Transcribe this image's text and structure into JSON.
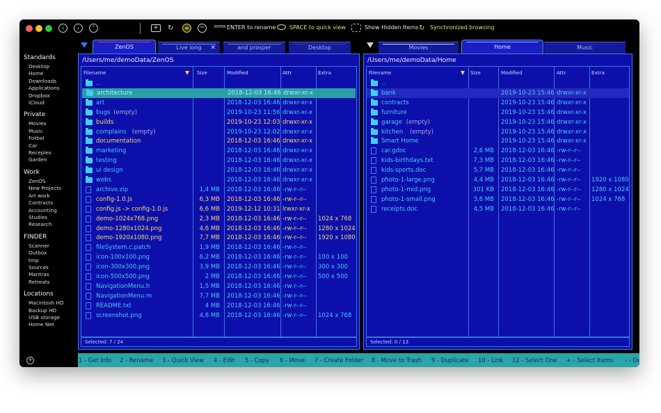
{
  "toolbar": {
    "nav": [
      "back",
      "forward",
      "up"
    ],
    "rename_hint_icon": "ENTER",
    "rename_hint": "ENTER to rename",
    "quickview_hint": "SPACE to quick view",
    "hidden_items": "Show Hidden Items",
    "sync_browsing": "Synchronized browsing"
  },
  "sidebar": {
    "groups": [
      {
        "title": "Standards",
        "items": [
          "Desktop",
          "Home",
          "Downloads",
          "Applications",
          "Dropbox",
          "iCloud"
        ]
      },
      {
        "title": "Private",
        "items": [
          "Movies",
          "Music",
          "Fotbal",
          "Car",
          "Recepies",
          "Garden"
        ]
      },
      {
        "title": "Work",
        "items": [
          "ZenOS",
          "New Projects",
          "Art work",
          "Contracts",
          "Accounting",
          "Studies",
          "Research"
        ]
      },
      {
        "title": "FINDER",
        "items": [
          "Scanner",
          "Outbox",
          "tmp",
          "Sources",
          "Mantras",
          "Retreats"
        ]
      },
      {
        "title": "Locations",
        "items": [
          "Macintosh HD",
          "Backup HD",
          "USB storage",
          "Home Net"
        ]
      }
    ],
    "add_icon": "+"
  },
  "left_tabs": [
    {
      "label": "ZenOS",
      "active": true,
      "accent": "#d83a6a"
    },
    {
      "label": "Live long",
      "active": false,
      "accent": "#6a8cff",
      "closable": true
    },
    {
      "label": "and prosper",
      "active": false,
      "accent": "#7a8aa0"
    },
    {
      "label": "Desktop",
      "active": false,
      "accent": "#5a2aa8"
    }
  ],
  "right_tabs": [
    {
      "label": "Movies",
      "active": false,
      "accent": "#cfd6ff"
    },
    {
      "label": "Home",
      "active": true,
      "accent": "#7fb0ff"
    },
    {
      "label": "Music",
      "active": false,
      "accent": "#1a1fc4"
    }
  ],
  "columns": {
    "filename": "Filename",
    "size": "Size",
    "modified": "Modified",
    "attr": "Attr",
    "extra": "Extra"
  },
  "left_pane": {
    "path": "/Users/me/demoData/ZenOS",
    "status": "Selected: 7 / 24",
    "rows": [
      {
        "type": "folder",
        "name": "..",
        "note": "",
        "size": "",
        "modified": "",
        "attr": "",
        "extra": "",
        "style": "default"
      },
      {
        "type": "folder",
        "name": "architecture",
        "note": "",
        "size": "",
        "modified": "2018-12-03 16:46",
        "attr": "drwxr-xr-x",
        "extra": "",
        "style": "cursor"
      },
      {
        "type": "folder",
        "name": "art",
        "note": "",
        "size": "",
        "modified": "2018-12-03 16:46",
        "attr": "drwxr-xr-x",
        "extra": "",
        "style": "default"
      },
      {
        "type": "folder",
        "name": "bugs",
        "note": "(empty)",
        "size": "",
        "modified": "2019-10-23 11:56",
        "attr": "drwxr-xr-x",
        "extra": "",
        "style": "default"
      },
      {
        "type": "folder",
        "name": "builds",
        "note": "",
        "size": "",
        "modified": "2019-10-23 12:03",
        "attr": "drwxr-xr-x",
        "extra": "",
        "style": "selected"
      },
      {
        "type": "folder",
        "name": "complains",
        "note": "(empty)",
        "size": "",
        "modified": "2019-10-23 12:02",
        "attr": "drwxr-xr-x",
        "extra": "",
        "style": "default"
      },
      {
        "type": "folder",
        "name": "documentation",
        "note": "",
        "size": "",
        "modified": "2018-12-03 16:46",
        "attr": "drwxr-xr-x",
        "extra": "",
        "style": "selected"
      },
      {
        "type": "folder",
        "name": "marketing",
        "note": "",
        "size": "",
        "modified": "2018-12-03 16:46",
        "attr": "drwxr-xr-x",
        "extra": "",
        "style": "default"
      },
      {
        "type": "folder",
        "name": "testing",
        "note": "",
        "size": "",
        "modified": "2018-12-03 16:46",
        "attr": "drwxr-xr-x",
        "extra": "",
        "style": "default"
      },
      {
        "type": "folder",
        "name": "ui design",
        "note": "",
        "size": "",
        "modified": "2018-12-03 16:46",
        "attr": "drwxr-xr-x",
        "extra": "",
        "style": "default"
      },
      {
        "type": "folder",
        "name": "webs",
        "note": "",
        "size": "",
        "modified": "2018-12-03 16:46",
        "attr": "drwxr-xr-x",
        "extra": "",
        "style": "default"
      },
      {
        "type": "file",
        "name": "archive.zip",
        "note": "",
        "size": "1,4 MB",
        "modified": "2018-12-03 16:46",
        "attr": "-rw-r--r--",
        "extra": "",
        "style": "default"
      },
      {
        "type": "file",
        "name": "config-1.0.js",
        "note": "",
        "size": "6,3 MB",
        "modified": "2018-12-03 16:46",
        "attr": "-rw-r--r--",
        "extra": "",
        "style": "selected"
      },
      {
        "type": "file",
        "name": "config.js -> config-1.0.js",
        "note": "",
        "size": "6,6 MB",
        "modified": "2019-12-12 10:31",
        "attr": "lrwxr-xr-x",
        "extra": "",
        "style": "selected"
      },
      {
        "type": "file",
        "name": "demo-1024x768.png",
        "note": "",
        "size": "2,3 MB",
        "modified": "2018-12-03 16:46",
        "attr": "-rw-r--r--",
        "extra": "1024 x 768",
        "style": "selected"
      },
      {
        "type": "file",
        "name": "demo-1280x1024.png",
        "note": "",
        "size": "4,6 MB",
        "modified": "2018-12-03 16:46",
        "attr": "-rw-r--r--",
        "extra": "1280 x 1024",
        "style": "selected"
      },
      {
        "type": "file",
        "name": "demo-1920x1080.png",
        "note": "",
        "size": "7,7 MB",
        "modified": "2018-12-03 16:46",
        "attr": "-rw-r--r--",
        "extra": "1920 x 1080",
        "style": "selected"
      },
      {
        "type": "file",
        "name": "fileSystem.c.patch",
        "note": "",
        "size": "1,9 MB",
        "modified": "2018-12-03 16:46",
        "attr": "-rw-r--r--",
        "extra": "",
        "style": "default"
      },
      {
        "type": "file",
        "name": "icon-100x100.png",
        "note": "",
        "size": "6,2 MB",
        "modified": "2018-12-03 16:46",
        "attr": "-rw-r--r--",
        "extra": "100 x 100",
        "style": "default"
      },
      {
        "type": "file",
        "name": "icon-300x300.png",
        "note": "",
        "size": "3,9 MB",
        "modified": "2018-12-03 16:46",
        "attr": "-rw-r--r--",
        "extra": "300 x 300",
        "style": "default"
      },
      {
        "type": "file",
        "name": "icon-500x500.png",
        "note": "",
        "size": "2 MB",
        "modified": "2018-12-03 16:46",
        "attr": "-rw-r--r--",
        "extra": "500 x 500",
        "style": "default"
      },
      {
        "type": "file",
        "name": "NavigationMenu.h",
        "note": "",
        "size": "1,5 MB",
        "modified": "2018-12-03 16:46",
        "attr": "-rw-r--r--",
        "extra": "",
        "style": "default"
      },
      {
        "type": "file",
        "name": "NavigationMenu.m",
        "note": "",
        "size": "7,7 MB",
        "modified": "2018-12-03 16:46",
        "attr": "-rw-r--r--",
        "extra": "",
        "style": "default"
      },
      {
        "type": "file",
        "name": "README.txt",
        "note": "",
        "size": "4 MB",
        "modified": "2018-12-03 16:46",
        "attr": "-rw-r--r--",
        "extra": "",
        "style": "default"
      },
      {
        "type": "file",
        "name": "screenshot.png",
        "note": "",
        "size": "4,6 MB",
        "modified": "2018-12-03 16:46",
        "attr": "-rw-r--r--",
        "extra": "1024 x 768",
        "style": "default"
      }
    ]
  },
  "right_pane": {
    "path": "/Users/me/demoData/Home",
    "status": "Selected: 0 / 13",
    "rows": [
      {
        "type": "folder",
        "name": "..",
        "note": "",
        "size": "",
        "modified": "",
        "attr": "",
        "extra": "",
        "style": "default"
      },
      {
        "type": "folder",
        "name": "bank",
        "note": "",
        "size": "",
        "modified": "2019-10-23 15:46",
        "attr": "drwxr-xr-x",
        "extra": "",
        "style": "inactive-cursor"
      },
      {
        "type": "folder",
        "name": "contracts",
        "note": "",
        "size": "",
        "modified": "2019-10-23 15:46",
        "attr": "drwxr-xr-x",
        "extra": "",
        "style": "default"
      },
      {
        "type": "folder",
        "name": "furniture",
        "note": "",
        "size": "",
        "modified": "2019-10-23 15:46",
        "attr": "drwxr-xr-x",
        "extra": "",
        "style": "default"
      },
      {
        "type": "folder",
        "name": "garage",
        "note": "(empty)",
        "size": "",
        "modified": "2019-10-23 15:46",
        "attr": "drwxr-xr-x",
        "extra": "",
        "style": "default"
      },
      {
        "type": "folder",
        "name": "kitchen",
        "note": "(empty)",
        "size": "",
        "modified": "2019-10-23 15:46",
        "attr": "drwxr-xr-x",
        "extra": "",
        "style": "default"
      },
      {
        "type": "folder",
        "name": "Smart Home",
        "note": "",
        "size": "",
        "modified": "2019-10-23 15:46",
        "attr": "drwxr-xr-x",
        "extra": "",
        "style": "default"
      },
      {
        "type": "file",
        "name": "car.gdoc",
        "note": "",
        "size": "2,6 MB",
        "modified": "2018-12-03 16:46",
        "attr": "-rw-r--r--",
        "extra": "",
        "style": "default"
      },
      {
        "type": "file",
        "name": "kids-birthdays.txt",
        "note": "",
        "size": "7,3 MB",
        "modified": "2018-12-03 16:46",
        "attr": "-rw-r--r--",
        "extra": "",
        "style": "default"
      },
      {
        "type": "file",
        "name": "kids-sports.doc",
        "note": "",
        "size": "5,7 MB",
        "modified": "2018-12-03 16:46",
        "attr": "-rw-r--r--",
        "extra": "",
        "style": "default"
      },
      {
        "type": "file",
        "name": "photo-1-large.png",
        "note": "",
        "size": "4,4 MB",
        "modified": "2018-12-03 16:46",
        "attr": "-rw-r--r--",
        "extra": "1920 x 1080",
        "style": "default"
      },
      {
        "type": "file",
        "name": "photo-1-mid.png",
        "note": "",
        "size": "301 KB",
        "modified": "2018-12-03 16:46",
        "attr": "-rw-r--r--",
        "extra": "1280 x 1024",
        "style": "default"
      },
      {
        "type": "file",
        "name": "photo-1-small.png",
        "note": "",
        "size": "3,6 MB",
        "modified": "2018-12-03 16:46",
        "attr": "-rw-r--r--",
        "extra": "1024 x 768",
        "style": "default"
      },
      {
        "type": "file",
        "name": "receipts.doc",
        "note": "",
        "size": "4,5 MB",
        "modified": "2018-12-03 16:46",
        "attr": "-rw-r--r--",
        "extra": "",
        "style": "default"
      }
    ]
  },
  "function_keys": [
    "1 - Get Info",
    "2 - Rename",
    "3 - Quick View",
    "4 - Edit",
    "5 - Copy",
    "6 - Move",
    "7 - Create Folder",
    "8 - Move to Trash",
    "9 - Duplicate",
    "10 - Link",
    "12 - Select One",
    "+ - Select Items",
    "- - Deselect Items"
  ],
  "colors": {
    "pane_bg": "#0d0fab",
    "cursor_row": "#2a9ea6",
    "default_text": "#48c8f4",
    "selected_text": "#f3d86a",
    "function_bar": "#2aa5a9"
  }
}
